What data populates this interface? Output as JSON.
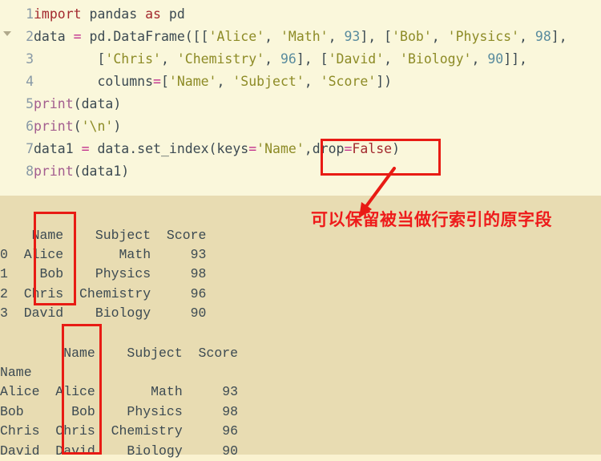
{
  "editor": {
    "theme_bg": "#faf7db",
    "output_bg": "#e8dcb2",
    "fold_arrow_icon": "chevron-down-icon",
    "colors": {
      "keyword": "#a32a2f",
      "string": "#8d8b26",
      "number": "#5a8c9e",
      "function": "#a35d8f",
      "operator": "#c2318d",
      "plain": "#3c4a52",
      "line_number": "#8899a6",
      "annotation_red": "#e81b14"
    },
    "lines": [
      {
        "number": "1",
        "tokens": [
          {
            "t": "import",
            "c": "kw"
          },
          {
            "t": " pandas ",
            "c": "plain"
          },
          {
            "t": "as",
            "c": "kw"
          },
          {
            "t": " pd",
            "c": "plain"
          }
        ]
      },
      {
        "number": "2",
        "tokens": [
          {
            "t": "data ",
            "c": "plain"
          },
          {
            "t": "=",
            "c": "op"
          },
          {
            "t": " pd.DataFrame([[",
            "c": "plain"
          },
          {
            "t": "'Alice'",
            "c": "str"
          },
          {
            "t": ", ",
            "c": "plain"
          },
          {
            "t": "'Math'",
            "c": "str"
          },
          {
            "t": ", ",
            "c": "plain"
          },
          {
            "t": "93",
            "c": "num"
          },
          {
            "t": "], [",
            "c": "plain"
          },
          {
            "t": "'Bob'",
            "c": "str"
          },
          {
            "t": ", ",
            "c": "plain"
          },
          {
            "t": "'Physics'",
            "c": "str"
          },
          {
            "t": ", ",
            "c": "plain"
          },
          {
            "t": "98",
            "c": "num"
          },
          {
            "t": "],",
            "c": "plain"
          }
        ]
      },
      {
        "number": "3",
        "tokens": [
          {
            "t": "        [",
            "c": "plain"
          },
          {
            "t": "'Chris'",
            "c": "str"
          },
          {
            "t": ", ",
            "c": "plain"
          },
          {
            "t": "'Chemistry'",
            "c": "str"
          },
          {
            "t": ", ",
            "c": "plain"
          },
          {
            "t": "96",
            "c": "num"
          },
          {
            "t": "], [",
            "c": "plain"
          },
          {
            "t": "'David'",
            "c": "str"
          },
          {
            "t": ", ",
            "c": "plain"
          },
          {
            "t": "'Biology'",
            "c": "str"
          },
          {
            "t": ", ",
            "c": "plain"
          },
          {
            "t": "90",
            "c": "num"
          },
          {
            "t": "]],",
            "c": "plain"
          }
        ]
      },
      {
        "number": "4",
        "tokens": [
          {
            "t": "        columns",
            "c": "plain"
          },
          {
            "t": "=",
            "c": "op"
          },
          {
            "t": "[",
            "c": "plain"
          },
          {
            "t": "'Name'",
            "c": "str"
          },
          {
            "t": ", ",
            "c": "plain"
          },
          {
            "t": "'Subject'",
            "c": "str"
          },
          {
            "t": ", ",
            "c": "plain"
          },
          {
            "t": "'Score'",
            "c": "str"
          },
          {
            "t": "])",
            "c": "plain"
          }
        ]
      },
      {
        "number": "5",
        "tokens": [
          {
            "t": "print",
            "c": "fn"
          },
          {
            "t": "(data)",
            "c": "plain"
          }
        ]
      },
      {
        "number": "6",
        "tokens": [
          {
            "t": "print",
            "c": "fn"
          },
          {
            "t": "(",
            "c": "plain"
          },
          {
            "t": "'\\n'",
            "c": "str"
          },
          {
            "t": ")",
            "c": "plain"
          }
        ]
      },
      {
        "number": "7",
        "tokens": [
          {
            "t": "data1 ",
            "c": "plain"
          },
          {
            "t": "=",
            "c": "op"
          },
          {
            "t": " data.set_index(keys",
            "c": "plain"
          },
          {
            "t": "=",
            "c": "op"
          },
          {
            "t": "'Name'",
            "c": "str"
          },
          {
            "t": ",drop",
            "c": "plain"
          },
          {
            "t": "=",
            "c": "op"
          },
          {
            "t": "False",
            "c": "kw"
          },
          {
            "t": ")",
            "c": "plain"
          }
        ]
      },
      {
        "number": "8",
        "tokens": [
          {
            "t": "print",
            "c": "fn"
          },
          {
            "t": "(data1)",
            "c": "plain"
          }
        ]
      }
    ]
  },
  "output": {
    "block1_text": "    Name    Subject  Score\n0  Alice       Math     93\n1    Bob    Physics     98\n2  Chris  Chemistry     96\n3  David    Biology     90",
    "block2_text": "        Name    Subject  Score\nName                          \nAlice  Alice       Math     93\nBob      Bob    Physics     98\nChris  Chris  Chemistry     96\nDavid  David    Biology     90",
    "table1": {
      "columns": [
        "",
        "Name",
        "Subject",
        "Score"
      ],
      "rows": [
        [
          "0",
          "Alice",
          "Math",
          "93"
        ],
        [
          "1",
          "Bob",
          "Physics",
          "98"
        ],
        [
          "2",
          "Chris",
          "Chemistry",
          "96"
        ],
        [
          "3",
          "David",
          "Biology",
          "90"
        ]
      ]
    },
    "table2": {
      "index_name": "Name",
      "columns": [
        "Name",
        "Subject",
        "Score"
      ],
      "rows": [
        [
          "Alice",
          "Alice",
          "Math",
          "93"
        ],
        [
          "Bob",
          "Bob",
          "Physics",
          "98"
        ],
        [
          "Chris",
          "Chris",
          "Chemistry",
          "96"
        ],
        [
          "David",
          "David",
          "Biology",
          "90"
        ]
      ]
    }
  },
  "annotations": {
    "note_text": "可以保留被当做行索引的原字段",
    "highlight_code_fragment": ",drop=False)",
    "highlight_column_1": "Name",
    "highlight_column_2": "Name"
  }
}
